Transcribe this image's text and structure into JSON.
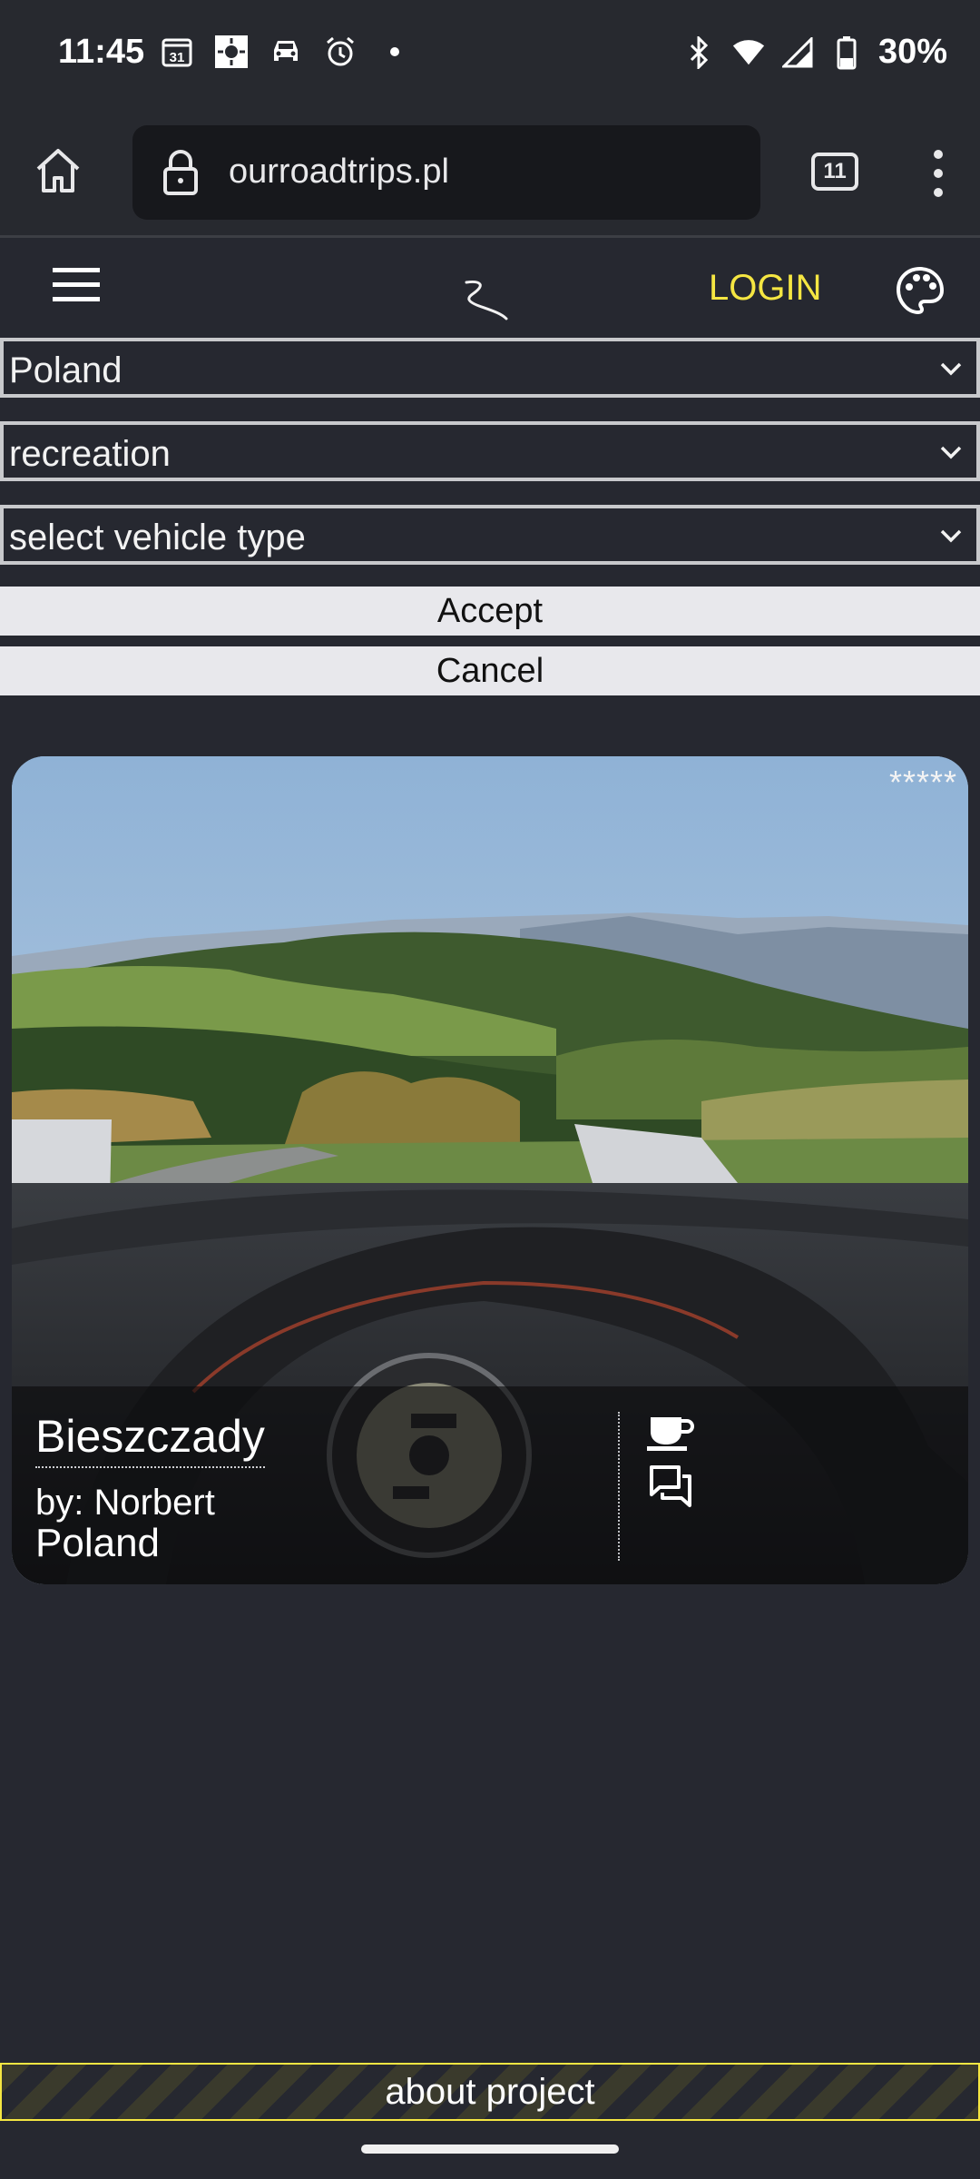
{
  "status_bar": {
    "time": "11:45",
    "left_icons": [
      "calendar-icon",
      "weather-icon",
      "car-icon",
      "alarm-icon",
      "dot-icon"
    ],
    "calendar_day": "31",
    "right_icons": [
      "bluetooth-icon",
      "wifi-icon",
      "signal-icon",
      "battery-icon"
    ],
    "battery": "30%"
  },
  "browser": {
    "url": "ourroadtrips.pl",
    "tab_count": "11"
  },
  "header": {
    "login_label": "LOGIN"
  },
  "filters": {
    "country": "Poland",
    "category": "recreation",
    "vehicle": "select vehicle type"
  },
  "actions": {
    "accept_label": "Accept",
    "cancel_label": "Cancel"
  },
  "card": {
    "rating": "*****",
    "title": "Bieszczady",
    "author": "by: Norbert",
    "country": "Poland"
  },
  "footer": {
    "about_label": "about project"
  },
  "colors": {
    "background": "#262830",
    "accent_yellow": "#f5e642",
    "button_bg": "#e8e8ec"
  }
}
